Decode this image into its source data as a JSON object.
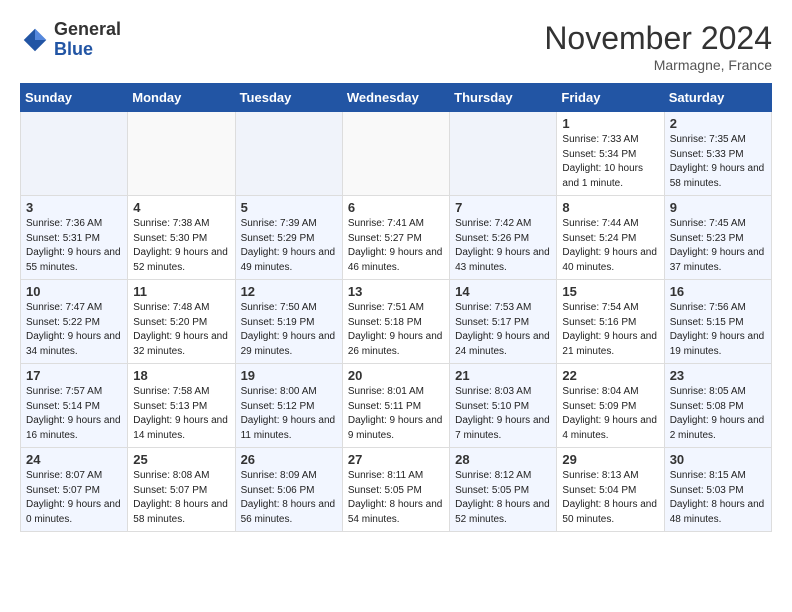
{
  "header": {
    "logo_general": "General",
    "logo_blue": "Blue",
    "month_title": "November 2024",
    "location": "Marmagne, France"
  },
  "weekdays": [
    "Sunday",
    "Monday",
    "Tuesday",
    "Wednesday",
    "Thursday",
    "Friday",
    "Saturday"
  ],
  "weeks": [
    [
      {
        "day": "",
        "sunrise": "",
        "sunset": "",
        "daylight": "",
        "empty": true
      },
      {
        "day": "",
        "sunrise": "",
        "sunset": "",
        "daylight": "",
        "empty": true
      },
      {
        "day": "",
        "sunrise": "",
        "sunset": "",
        "daylight": "",
        "empty": true
      },
      {
        "day": "",
        "sunrise": "",
        "sunset": "",
        "daylight": "",
        "empty": true
      },
      {
        "day": "",
        "sunrise": "",
        "sunset": "",
        "daylight": "",
        "empty": true
      },
      {
        "day": "1",
        "sunrise": "Sunrise: 7:33 AM",
        "sunset": "Sunset: 5:34 PM",
        "daylight": "Daylight: 10 hours and 1 minute.",
        "empty": false
      },
      {
        "day": "2",
        "sunrise": "Sunrise: 7:35 AM",
        "sunset": "Sunset: 5:33 PM",
        "daylight": "Daylight: 9 hours and 58 minutes.",
        "empty": false
      }
    ],
    [
      {
        "day": "3",
        "sunrise": "Sunrise: 7:36 AM",
        "sunset": "Sunset: 5:31 PM",
        "daylight": "Daylight: 9 hours and 55 minutes.",
        "empty": false
      },
      {
        "day": "4",
        "sunrise": "Sunrise: 7:38 AM",
        "sunset": "Sunset: 5:30 PM",
        "daylight": "Daylight: 9 hours and 52 minutes.",
        "empty": false
      },
      {
        "day": "5",
        "sunrise": "Sunrise: 7:39 AM",
        "sunset": "Sunset: 5:29 PM",
        "daylight": "Daylight: 9 hours and 49 minutes.",
        "empty": false
      },
      {
        "day": "6",
        "sunrise": "Sunrise: 7:41 AM",
        "sunset": "Sunset: 5:27 PM",
        "daylight": "Daylight: 9 hours and 46 minutes.",
        "empty": false
      },
      {
        "day": "7",
        "sunrise": "Sunrise: 7:42 AM",
        "sunset": "Sunset: 5:26 PM",
        "daylight": "Daylight: 9 hours and 43 minutes.",
        "empty": false
      },
      {
        "day": "8",
        "sunrise": "Sunrise: 7:44 AM",
        "sunset": "Sunset: 5:24 PM",
        "daylight": "Daylight: 9 hours and 40 minutes.",
        "empty": false
      },
      {
        "day": "9",
        "sunrise": "Sunrise: 7:45 AM",
        "sunset": "Sunset: 5:23 PM",
        "daylight": "Daylight: 9 hours and 37 minutes.",
        "empty": false
      }
    ],
    [
      {
        "day": "10",
        "sunrise": "Sunrise: 7:47 AM",
        "sunset": "Sunset: 5:22 PM",
        "daylight": "Daylight: 9 hours and 34 minutes.",
        "empty": false
      },
      {
        "day": "11",
        "sunrise": "Sunrise: 7:48 AM",
        "sunset": "Sunset: 5:20 PM",
        "daylight": "Daylight: 9 hours and 32 minutes.",
        "empty": false
      },
      {
        "day": "12",
        "sunrise": "Sunrise: 7:50 AM",
        "sunset": "Sunset: 5:19 PM",
        "daylight": "Daylight: 9 hours and 29 minutes.",
        "empty": false
      },
      {
        "day": "13",
        "sunrise": "Sunrise: 7:51 AM",
        "sunset": "Sunset: 5:18 PM",
        "daylight": "Daylight: 9 hours and 26 minutes.",
        "empty": false
      },
      {
        "day": "14",
        "sunrise": "Sunrise: 7:53 AM",
        "sunset": "Sunset: 5:17 PM",
        "daylight": "Daylight: 9 hours and 24 minutes.",
        "empty": false
      },
      {
        "day": "15",
        "sunrise": "Sunrise: 7:54 AM",
        "sunset": "Sunset: 5:16 PM",
        "daylight": "Daylight: 9 hours and 21 minutes.",
        "empty": false
      },
      {
        "day": "16",
        "sunrise": "Sunrise: 7:56 AM",
        "sunset": "Sunset: 5:15 PM",
        "daylight": "Daylight: 9 hours and 19 minutes.",
        "empty": false
      }
    ],
    [
      {
        "day": "17",
        "sunrise": "Sunrise: 7:57 AM",
        "sunset": "Sunset: 5:14 PM",
        "daylight": "Daylight: 9 hours and 16 minutes.",
        "empty": false
      },
      {
        "day": "18",
        "sunrise": "Sunrise: 7:58 AM",
        "sunset": "Sunset: 5:13 PM",
        "daylight": "Daylight: 9 hours and 14 minutes.",
        "empty": false
      },
      {
        "day": "19",
        "sunrise": "Sunrise: 8:00 AM",
        "sunset": "Sunset: 5:12 PM",
        "daylight": "Daylight: 9 hours and 11 minutes.",
        "empty": false
      },
      {
        "day": "20",
        "sunrise": "Sunrise: 8:01 AM",
        "sunset": "Sunset: 5:11 PM",
        "daylight": "Daylight: 9 hours and 9 minutes.",
        "empty": false
      },
      {
        "day": "21",
        "sunrise": "Sunrise: 8:03 AM",
        "sunset": "Sunset: 5:10 PM",
        "daylight": "Daylight: 9 hours and 7 minutes.",
        "empty": false
      },
      {
        "day": "22",
        "sunrise": "Sunrise: 8:04 AM",
        "sunset": "Sunset: 5:09 PM",
        "daylight": "Daylight: 9 hours and 4 minutes.",
        "empty": false
      },
      {
        "day": "23",
        "sunrise": "Sunrise: 8:05 AM",
        "sunset": "Sunset: 5:08 PM",
        "daylight": "Daylight: 9 hours and 2 minutes.",
        "empty": false
      }
    ],
    [
      {
        "day": "24",
        "sunrise": "Sunrise: 8:07 AM",
        "sunset": "Sunset: 5:07 PM",
        "daylight": "Daylight: 9 hours and 0 minutes.",
        "empty": false
      },
      {
        "day": "25",
        "sunrise": "Sunrise: 8:08 AM",
        "sunset": "Sunset: 5:07 PM",
        "daylight": "Daylight: 8 hours and 58 minutes.",
        "empty": false
      },
      {
        "day": "26",
        "sunrise": "Sunrise: 8:09 AM",
        "sunset": "Sunset: 5:06 PM",
        "daylight": "Daylight: 8 hours and 56 minutes.",
        "empty": false
      },
      {
        "day": "27",
        "sunrise": "Sunrise: 8:11 AM",
        "sunset": "Sunset: 5:05 PM",
        "daylight": "Daylight: 8 hours and 54 minutes.",
        "empty": false
      },
      {
        "day": "28",
        "sunrise": "Sunrise: 8:12 AM",
        "sunset": "Sunset: 5:05 PM",
        "daylight": "Daylight: 8 hours and 52 minutes.",
        "empty": false
      },
      {
        "day": "29",
        "sunrise": "Sunrise: 8:13 AM",
        "sunset": "Sunset: 5:04 PM",
        "daylight": "Daylight: 8 hours and 50 minutes.",
        "empty": false
      },
      {
        "day": "30",
        "sunrise": "Sunrise: 8:15 AM",
        "sunset": "Sunset: 5:03 PM",
        "daylight": "Daylight: 8 hours and 48 minutes.",
        "empty": false
      }
    ]
  ]
}
